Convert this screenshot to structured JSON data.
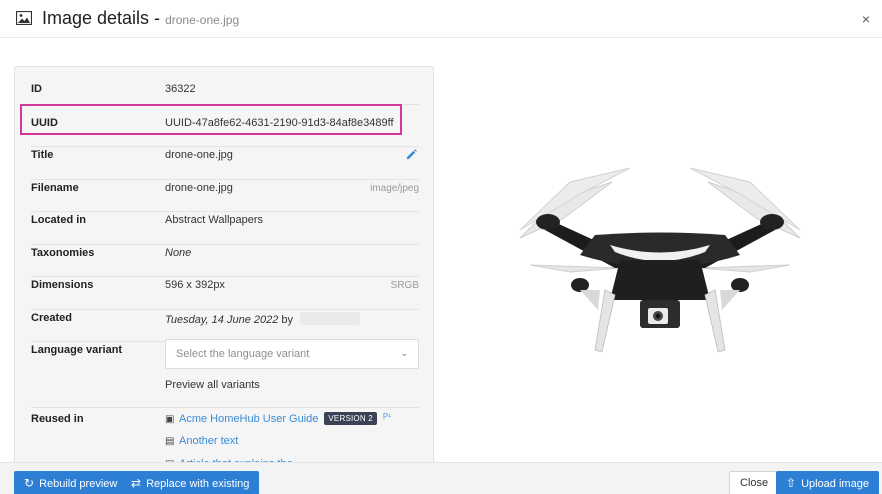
{
  "header": {
    "title": "Image details -",
    "filename": "drone-one.jpg",
    "close_label": "×"
  },
  "details": {
    "id_label": "ID",
    "id_value": "36322",
    "uuid_label": "UUID",
    "uuid_value": "UUID-47a8fe62-4631-2190-91d3-84af8e3489ff",
    "title_label": "Title",
    "title_value": "drone-one.jpg",
    "filename_label": "Filename",
    "filename_value": "drone-one.jpg",
    "filename_mime": "image/jpeg",
    "located_label": "Located in",
    "located_value": "Abstract Wallpapers",
    "taxonomies_label": "Taxonomies",
    "taxonomies_value": "None",
    "dimensions_label": "Dimensions",
    "dimensions_value": "596 x 392px",
    "dimensions_color": "SRGB",
    "created_label": "Created",
    "created_value": "Tuesday, 14 June 2022",
    "created_by": "by",
    "language_label": "Language variant",
    "language_placeholder": "Select the language variant",
    "preview_variants": "Preview all variants",
    "reused_label": "Reused in",
    "reused_items": [
      {
        "icon": "book-icon",
        "text": "Acme HomeHub User Guide",
        "badge": "VERSION 2",
        "sup": "P¹"
      },
      {
        "icon": "document-icon",
        "text": "Another text"
      },
      {
        "icon": "document-icon",
        "text": "Article that explains the..."
      }
    ]
  },
  "footer": {
    "rebuild_label": "Rebuild preview",
    "replace_label": "Replace with existing",
    "close_label": "Close",
    "upload_label": "Upload image"
  },
  "colors": {
    "accent": "#2c7fd4",
    "link": "#3a8bd6",
    "highlight": "#d2379c",
    "badge": "#3c4255"
  }
}
